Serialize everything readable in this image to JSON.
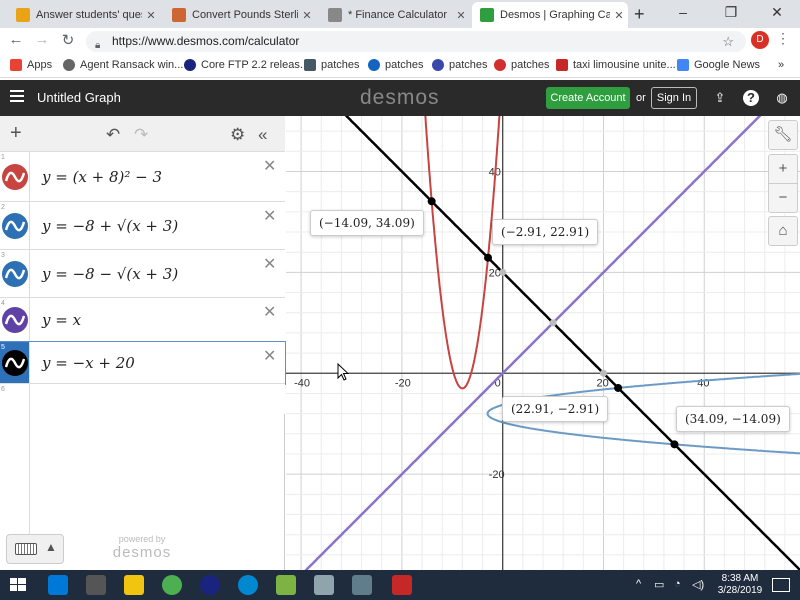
{
  "browser": {
    "tabs": [
      {
        "label": "Answer students' questio",
        "color": "#e8a317"
      },
      {
        "label": "Convert Pounds Sterling",
        "color": "#cc6633"
      },
      {
        "label": "* Finance Calculator",
        "color": "#888888"
      },
      {
        "label": "Desmos | Graphing Calcu",
        "color": "#2f9e3e",
        "active": true
      }
    ],
    "url": "https://www.desmos.com/calculator",
    "profile_initial": "D",
    "bookmarks": [
      {
        "label": "Apps",
        "color": "#e94235"
      },
      {
        "label": "Agent Ransack win...",
        "color": "#666666"
      },
      {
        "label": "Core FTP 2.2 releas...",
        "color": "#1a237e"
      },
      {
        "label": "patches",
        "color": "#455a64"
      },
      {
        "label": "patches",
        "color": "#1565c0"
      },
      {
        "label": "patches",
        "color": "#3949ab"
      },
      {
        "label": "patches",
        "color": "#d32f2f"
      },
      {
        "label": "taxi limousine unite...",
        "color": "#c62828"
      },
      {
        "label": "Google News",
        "color": "#4285f4"
      }
    ],
    "more_bookmarks": "»"
  },
  "desmos": {
    "graph_title": "Untitled Graph",
    "logo": "desmos",
    "create_account": "Create Account",
    "or": "or",
    "sign_in": "Sign In",
    "powered_by": "powered by",
    "powered_logo": "desmos"
  },
  "expressions": [
    {
      "index": "1",
      "text": "y = (x + 8)² − 3",
      "color": "#c74440"
    },
    {
      "index": "2",
      "text": "y = −8 + √(x + 3)",
      "color": "#2d70b3"
    },
    {
      "index": "3",
      "text": "y = −8 − √(x + 3)",
      "color": "#2d70b3"
    },
    {
      "index": "4",
      "text": "y = x",
      "color": "#6042a6"
    },
    {
      "index": "5",
      "text": "y = −x + 20",
      "color": "#000000",
      "selected": true
    },
    {
      "index": "6",
      "text": "",
      "color": ""
    }
  ],
  "chart_data": {
    "type": "line",
    "xlim": [
      -43,
      59
    ],
    "ylim": [
      -39,
      51
    ],
    "grid": true,
    "x_ticks": [
      "-40",
      "-20",
      "0",
      "20",
      "40"
    ],
    "y_ticks": [
      "40",
      "20",
      "-20"
    ],
    "series": [
      {
        "fn": "parabola",
        "color": "#c74440"
      },
      {
        "fn": "sqrt_upper",
        "color": "#6b9ac4"
      },
      {
        "fn": "sqrt_lower",
        "color": "#6b9ac4"
      },
      {
        "fn": "identity",
        "color": "#8a73c8"
      },
      {
        "fn": "neg_plus_20",
        "color": "#000000"
      }
    ],
    "points": [
      {
        "label": "(−14.09, 34.09)",
        "x": -14.09,
        "y": 34.09
      },
      {
        "label": "(−2.91, 22.91)",
        "x": -2.91,
        "y": 22.91
      },
      {
        "label": "(22.91, −2.91)",
        "x": 22.91,
        "y": -2.91
      },
      {
        "label": "(34.09, −14.09)",
        "x": 34.09,
        "y": -14.09
      }
    ]
  },
  "taskbar": {
    "time": "8:38 AM",
    "date": "3/28/2019"
  }
}
